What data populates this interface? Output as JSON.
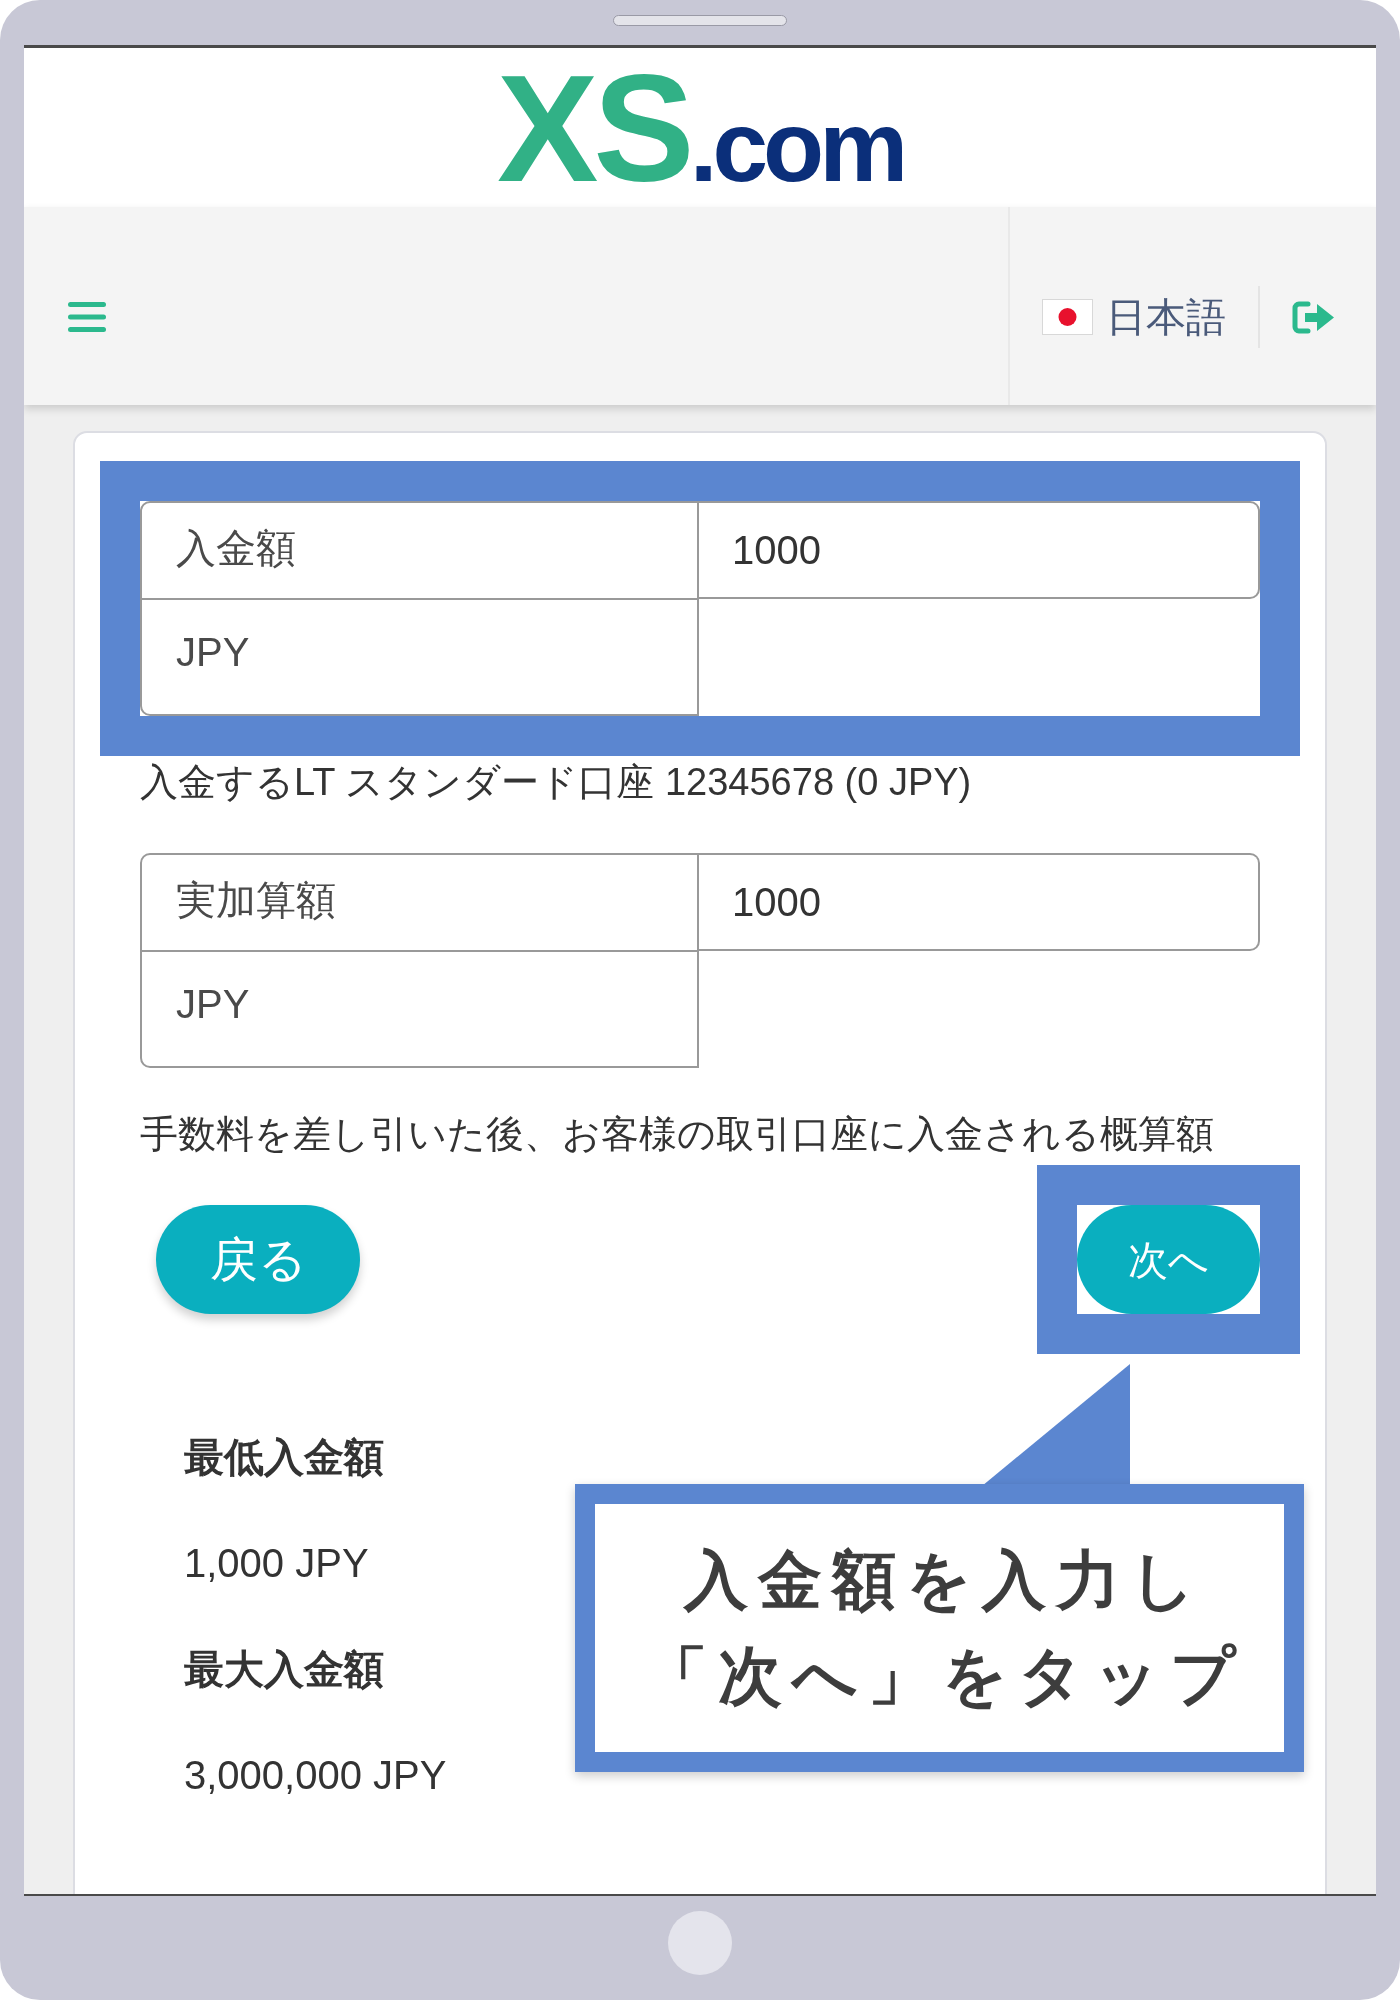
{
  "header": {
    "logo": {
      "mark": "XS",
      "suffix": ".com"
    }
  },
  "nav": {
    "language": {
      "label": "日本語"
    }
  },
  "form": {
    "fields": [
      {
        "label": "入金額",
        "currency": "JPY",
        "value": "1000",
        "note": "入金するLT スタンダード口座 12345678 (0 JPY)",
        "highlighted": true
      },
      {
        "label": "実加算額",
        "currency": "JPY",
        "value": "1000",
        "note": "手数料を差し引いた後、お客様の取引口座に入金される概算額",
        "highlighted": false
      }
    ],
    "buttons": [
      {
        "label": "戻る",
        "kind": "back",
        "highlighted": false
      },
      {
        "label": "次へ",
        "kind": "next",
        "highlighted": true
      }
    ]
  },
  "limits": [
    {
      "label": "最低入金額",
      "value": "1,000 JPY"
    },
    {
      "label": "最大入金額",
      "value": "3,000,000 JPY"
    }
  ],
  "callout": {
    "lines": [
      "入金額を入力し",
      "「次へ」をタップ"
    ]
  }
}
